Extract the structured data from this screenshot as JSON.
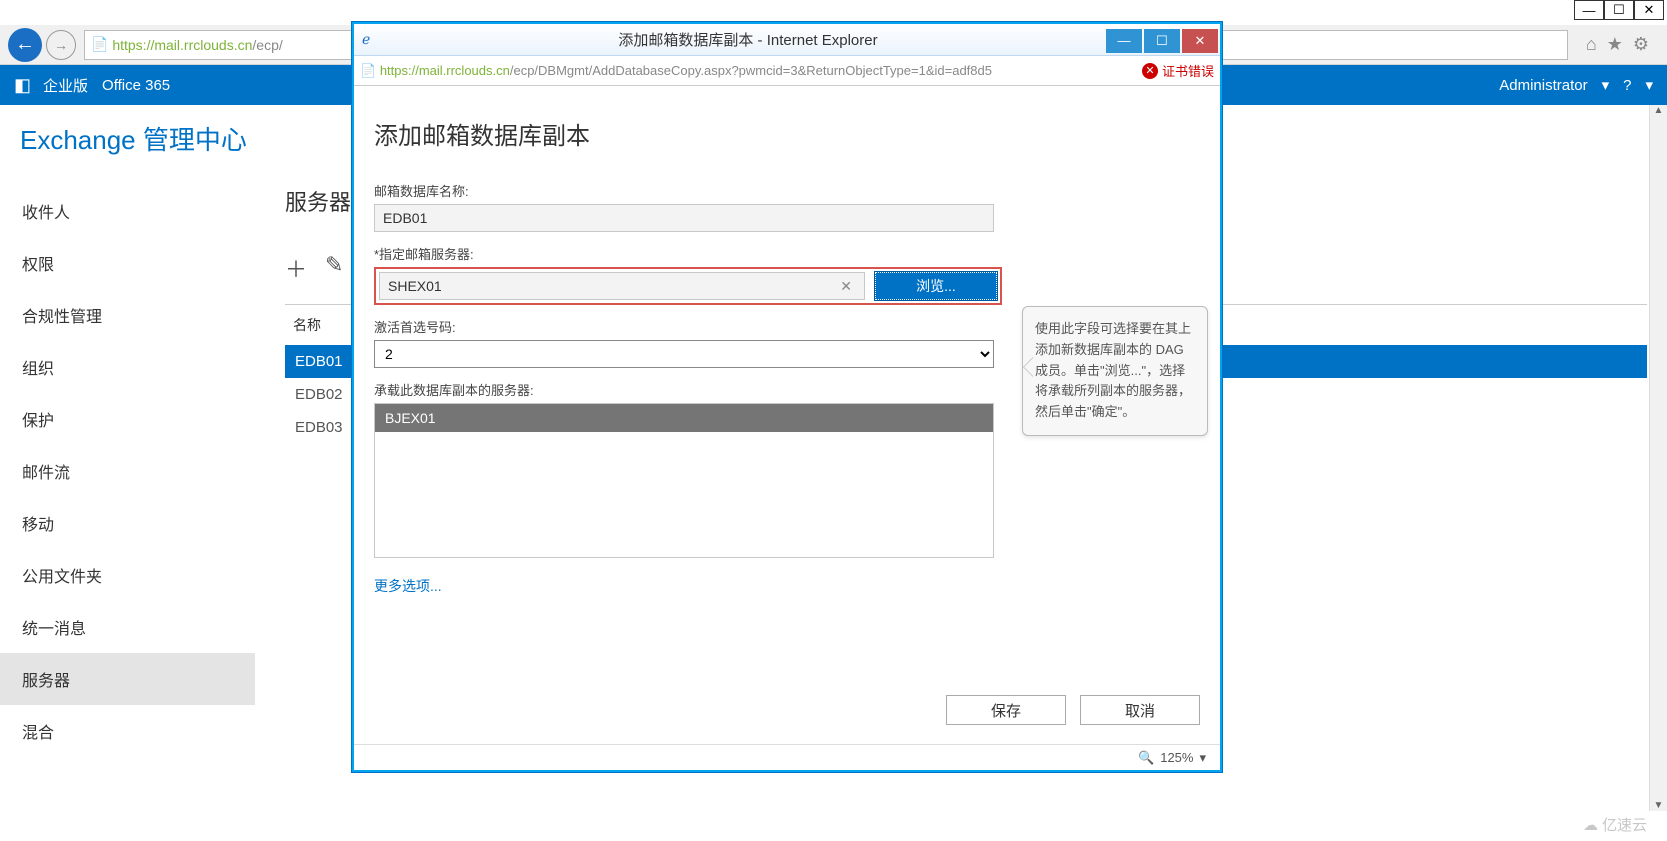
{
  "outer": {
    "url_host": "https://mail.rrclouds.cn",
    "url_path": "/ecp/"
  },
  "o365": {
    "enterprise": "企业版",
    "product": "Office 365",
    "user": "Administrator"
  },
  "eac_title": "Exchange 管理中心",
  "sidebar": {
    "items": [
      "收件人",
      "权限",
      "合规性管理",
      "组织",
      "保护",
      "邮件流",
      "移动",
      "公用文件夹",
      "统一消息",
      "服务器",
      "混合"
    ],
    "active_index": 9
  },
  "main": {
    "sub_tab": "服务器",
    "list_header": "名称",
    "databases": [
      "EDB01",
      "EDB02",
      "EDB03"
    ],
    "selected_index": 0
  },
  "popup": {
    "title": "添加邮箱数据库副本 - Internet Explorer",
    "url_host": "https://mail.rrclouds.cn",
    "url_path": "/ecp/DBMgmt/AddDatabaseCopy.aspx?pwmcid=3&ReturnObjectType=1&id=adf8d5",
    "cert_error": "证书错误",
    "heading": "添加邮箱数据库副本",
    "labels": {
      "db_name": "邮箱数据库名称:",
      "server": "*指定邮箱服务器:",
      "pref": "激活首选号码:",
      "copies": "承载此数据库副本的服务器:"
    },
    "db_name_value": "EDB01",
    "server_value": "SHEX01",
    "browse_label": "浏览...",
    "pref_value": "2",
    "copy_servers": [
      "BJEX01"
    ],
    "more_link": "更多选项...",
    "help_text": "使用此字段可选择要在其上添加新数据库副本的 DAG 成员。单击\"浏览...\"，选择将承载所列副本的服务器，然后单击\"确定\"。",
    "save": "保存",
    "cancel": "取消",
    "zoom": "125%"
  },
  "watermark": "亿速云"
}
